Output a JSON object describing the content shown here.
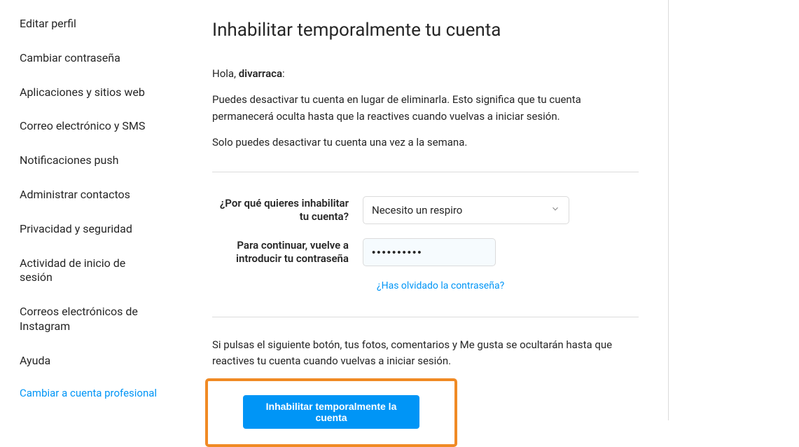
{
  "sidebar": {
    "items": [
      {
        "label": "Editar perfil"
      },
      {
        "label": "Cambiar contraseña"
      },
      {
        "label": "Aplicaciones y sitios web"
      },
      {
        "label": "Correo electrónico y SMS"
      },
      {
        "label": "Notificaciones push"
      },
      {
        "label": "Administrar contactos"
      },
      {
        "label": "Privacidad y seguridad"
      },
      {
        "label": "Actividad de inicio de sesión"
      },
      {
        "label": "Correos electrónicos de Instagram"
      },
      {
        "label": "Ayuda"
      }
    ],
    "switch_link": "Cambiar a cuenta profesional"
  },
  "main": {
    "title": "Inhabilitar temporalmente tu cuenta",
    "greeting_prefix": "Hola, ",
    "username": "divarraca",
    "greeting_suffix": ":",
    "desc1": "Puedes desactivar tu cuenta en lugar de eliminarla. Esto significa que tu cuenta permanecerá oculta hasta que la reactives cuando vuelvas a iniciar sesión.",
    "desc2": "Solo puedes desactivar tu cuenta una vez a la semana.",
    "reason_label": "¿Por qué quieres inhabilitar tu cuenta?",
    "reason_value": "Necesito un respiro",
    "password_label": "Para continuar, vuelve a introducir tu contraseña",
    "password_value": "••••••••••",
    "forgot_link": "¿Has olvidado la contraseña?",
    "final_text": "Si pulsas el siguiente botón, tus fotos, comentarios y Me gusta se ocultarán hasta que reactives tu cuenta cuando vuelvas a iniciar sesión.",
    "disable_button": "Inhabilitar temporalmente la cuenta"
  }
}
